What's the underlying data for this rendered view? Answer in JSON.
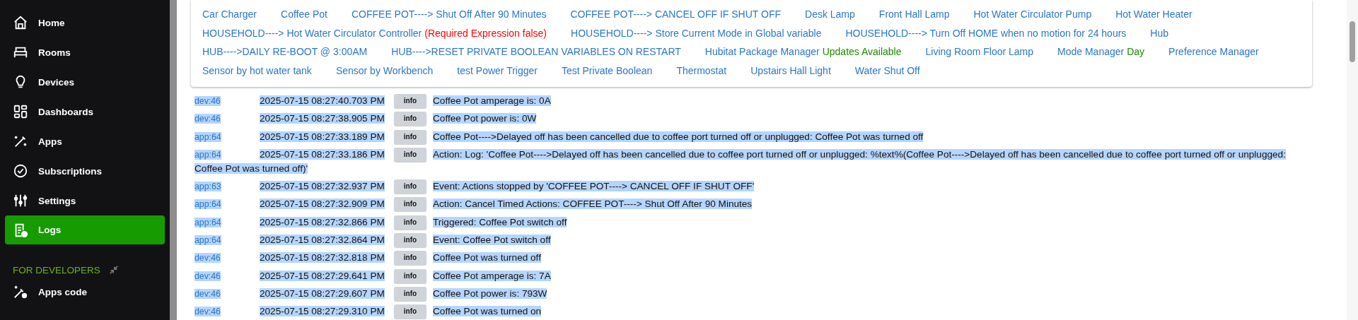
{
  "sidebar": {
    "items": [
      {
        "label": "Home",
        "selected": false
      },
      {
        "label": "Rooms",
        "selected": false
      },
      {
        "label": "Devices",
        "selected": false
      },
      {
        "label": "Dashboards",
        "selected": false
      },
      {
        "label": "Apps",
        "selected": false
      },
      {
        "label": "Subscriptions",
        "selected": false
      },
      {
        "label": "Settings",
        "selected": false
      },
      {
        "label": "Logs",
        "selected": true
      }
    ],
    "section": {
      "title": "FOR DEVELOPERS",
      "items": [
        {
          "label": "Apps code",
          "selected": false
        }
      ]
    }
  },
  "apps": [
    {
      "label": "Car Charger"
    },
    {
      "label": "Coffee Pot"
    },
    {
      "label": "COFFEE POT----> Shut Off After 90 Minutes"
    },
    {
      "label": "COFFEE POT----> CANCEL OFF IF SHUT OFF"
    },
    {
      "label": "Desk Lamp"
    },
    {
      "label": "Front Hall Lamp"
    },
    {
      "label": "Hot Water Circulator Pump"
    },
    {
      "label": "Hot Water Heater"
    },
    {
      "label": "HOUSEHOLD----> Hot Water Circulator Controller",
      "status": {
        "text": "(Required Expression false)",
        "color": "#ff0000"
      }
    },
    {
      "label": "HOUSEHOLD----> Store Current Mode in Global variable"
    },
    {
      "label": "HOUSEHOLD----> Turn Off HOME when no motion for 24 hours"
    },
    {
      "label": "Hub"
    },
    {
      "label": "HUB---->DAILY RE-BOOT @ 3:00AM"
    },
    {
      "label": "HUB---->RESET PRIVATE BOOLEAN VARIABLES ON RESTART"
    },
    {
      "label": "Hubitat Package Manager",
      "status": {
        "text": "Updates Available",
        "color": "#1e8a00"
      }
    },
    {
      "label": "Living Room Floor Lamp"
    },
    {
      "label": "Mode Manager",
      "status": {
        "text": "Day",
        "color": "#1e8a00"
      }
    },
    {
      "label": "Preference Manager"
    },
    {
      "label": "Sensor by hot water tank"
    },
    {
      "label": "Sensor by Workbench"
    },
    {
      "label": "test Power Trigger"
    },
    {
      "label": "Test Private Boolean"
    },
    {
      "label": "Thermostat"
    },
    {
      "label": "Upstairs Hall Light"
    },
    {
      "label": "Water Shut Off"
    }
  ],
  "log": [
    {
      "source": "dev:46",
      "time": "2025-07-15 08:27:40.703 PM",
      "level": "info",
      "message": "Coffee Pot amperage is: 0A",
      "selected": true
    },
    {
      "source": "dev:46",
      "time": "2025-07-15 08:27:38.905 PM",
      "level": "info",
      "message": "Coffee Pot power is: 0W",
      "selected": true
    },
    {
      "source": "app:64",
      "time": "2025-07-15 08:27:33.189 PM",
      "level": "info",
      "message": "Coffee Pot---->Delayed off has been cancelled due to coffee port turned off or unplugged: Coffee Pot was turned off",
      "selected": true
    },
    {
      "source": "app:64",
      "time": "2025-07-15 08:27:33.186 PM",
      "level": "info",
      "message": "Action: Log: 'Coffee Pot---->Delayed off has been cancelled due to coffee port turned off or unplugged: %text%(Coffee Pot---->Delayed off has been cancelled due to coffee port turned off or unplugged: Coffee Pot was turned off)'",
      "selected": true
    },
    {
      "source": "app:63",
      "time": "2025-07-15 08:27:32.937 PM",
      "level": "info",
      "message": "Event: Actions stopped by 'COFFEE POT----> CANCEL OFF IF SHUT OFF'",
      "selected": true
    },
    {
      "source": "app:64",
      "time": "2025-07-15 08:27:32.909 PM",
      "level": "info",
      "message": "Action: Cancel Timed Actions: COFFEE POT----> Shut Off After 90 Minutes",
      "selected": true
    },
    {
      "source": "app:64",
      "time": "2025-07-15 08:27:32.866 PM",
      "level": "info",
      "message": "Triggered: Coffee Pot switch off",
      "selected": true
    },
    {
      "source": "app:64",
      "time": "2025-07-15 08:27:32.864 PM",
      "level": "info",
      "message": "Event: Coffee Pot switch off",
      "selected": true
    },
    {
      "source": "dev:46",
      "time": "2025-07-15 08:27:32.818 PM",
      "level": "info",
      "message": "Coffee Pot was turned off",
      "selected": true
    },
    {
      "source": "dev:46",
      "time": "2025-07-15 08:27:29.641 PM",
      "level": "info",
      "message": "Coffee Pot amperage is: 7A",
      "selected": true
    },
    {
      "source": "dev:46",
      "time": "2025-07-15 08:27:29.607 PM",
      "level": "info",
      "message": "Coffee Pot power is: 793W",
      "selected": true
    },
    {
      "source": "dev:46",
      "time": "2025-07-15 08:27:29.310 PM",
      "level": "info",
      "message": "Coffee Pot was turned on",
      "selected": true
    }
  ]
}
